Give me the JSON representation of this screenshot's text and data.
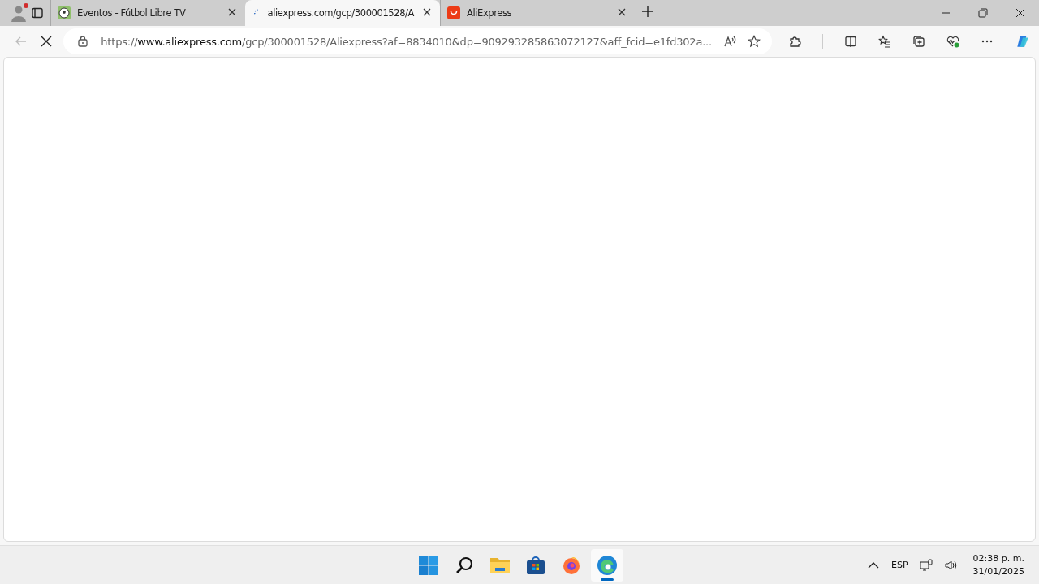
{
  "tabs": [
    {
      "kind": "soccer",
      "title": "Eventos - Fútbol Libre TV",
      "selected": false
    },
    {
      "kind": "loading",
      "title": "aliexpress.com/gcp/300001528/A",
      "selected": true
    },
    {
      "kind": "shop",
      "title": "AliExpress",
      "selected": false
    }
  ],
  "address_bar": {
    "scheme": "https://",
    "host": "www.aliexpress.com",
    "rest": "/gcp/300001528/Aliexpress?af=8834010&dp=909293285863072127&aff_fcid=e1fd302a..."
  },
  "page_loading": true,
  "taskbar": {
    "apps": [
      {
        "kind": "start",
        "active": false
      },
      {
        "kind": "search",
        "active": false
      },
      {
        "kind": "folder",
        "active": false
      },
      {
        "kind": "store",
        "active": false
      },
      {
        "kind": "firefox",
        "active": false
      },
      {
        "kind": "edge",
        "active": true
      }
    ],
    "language": "ESP",
    "time": "02:38 p. m.",
    "date": "31/01/2025"
  }
}
